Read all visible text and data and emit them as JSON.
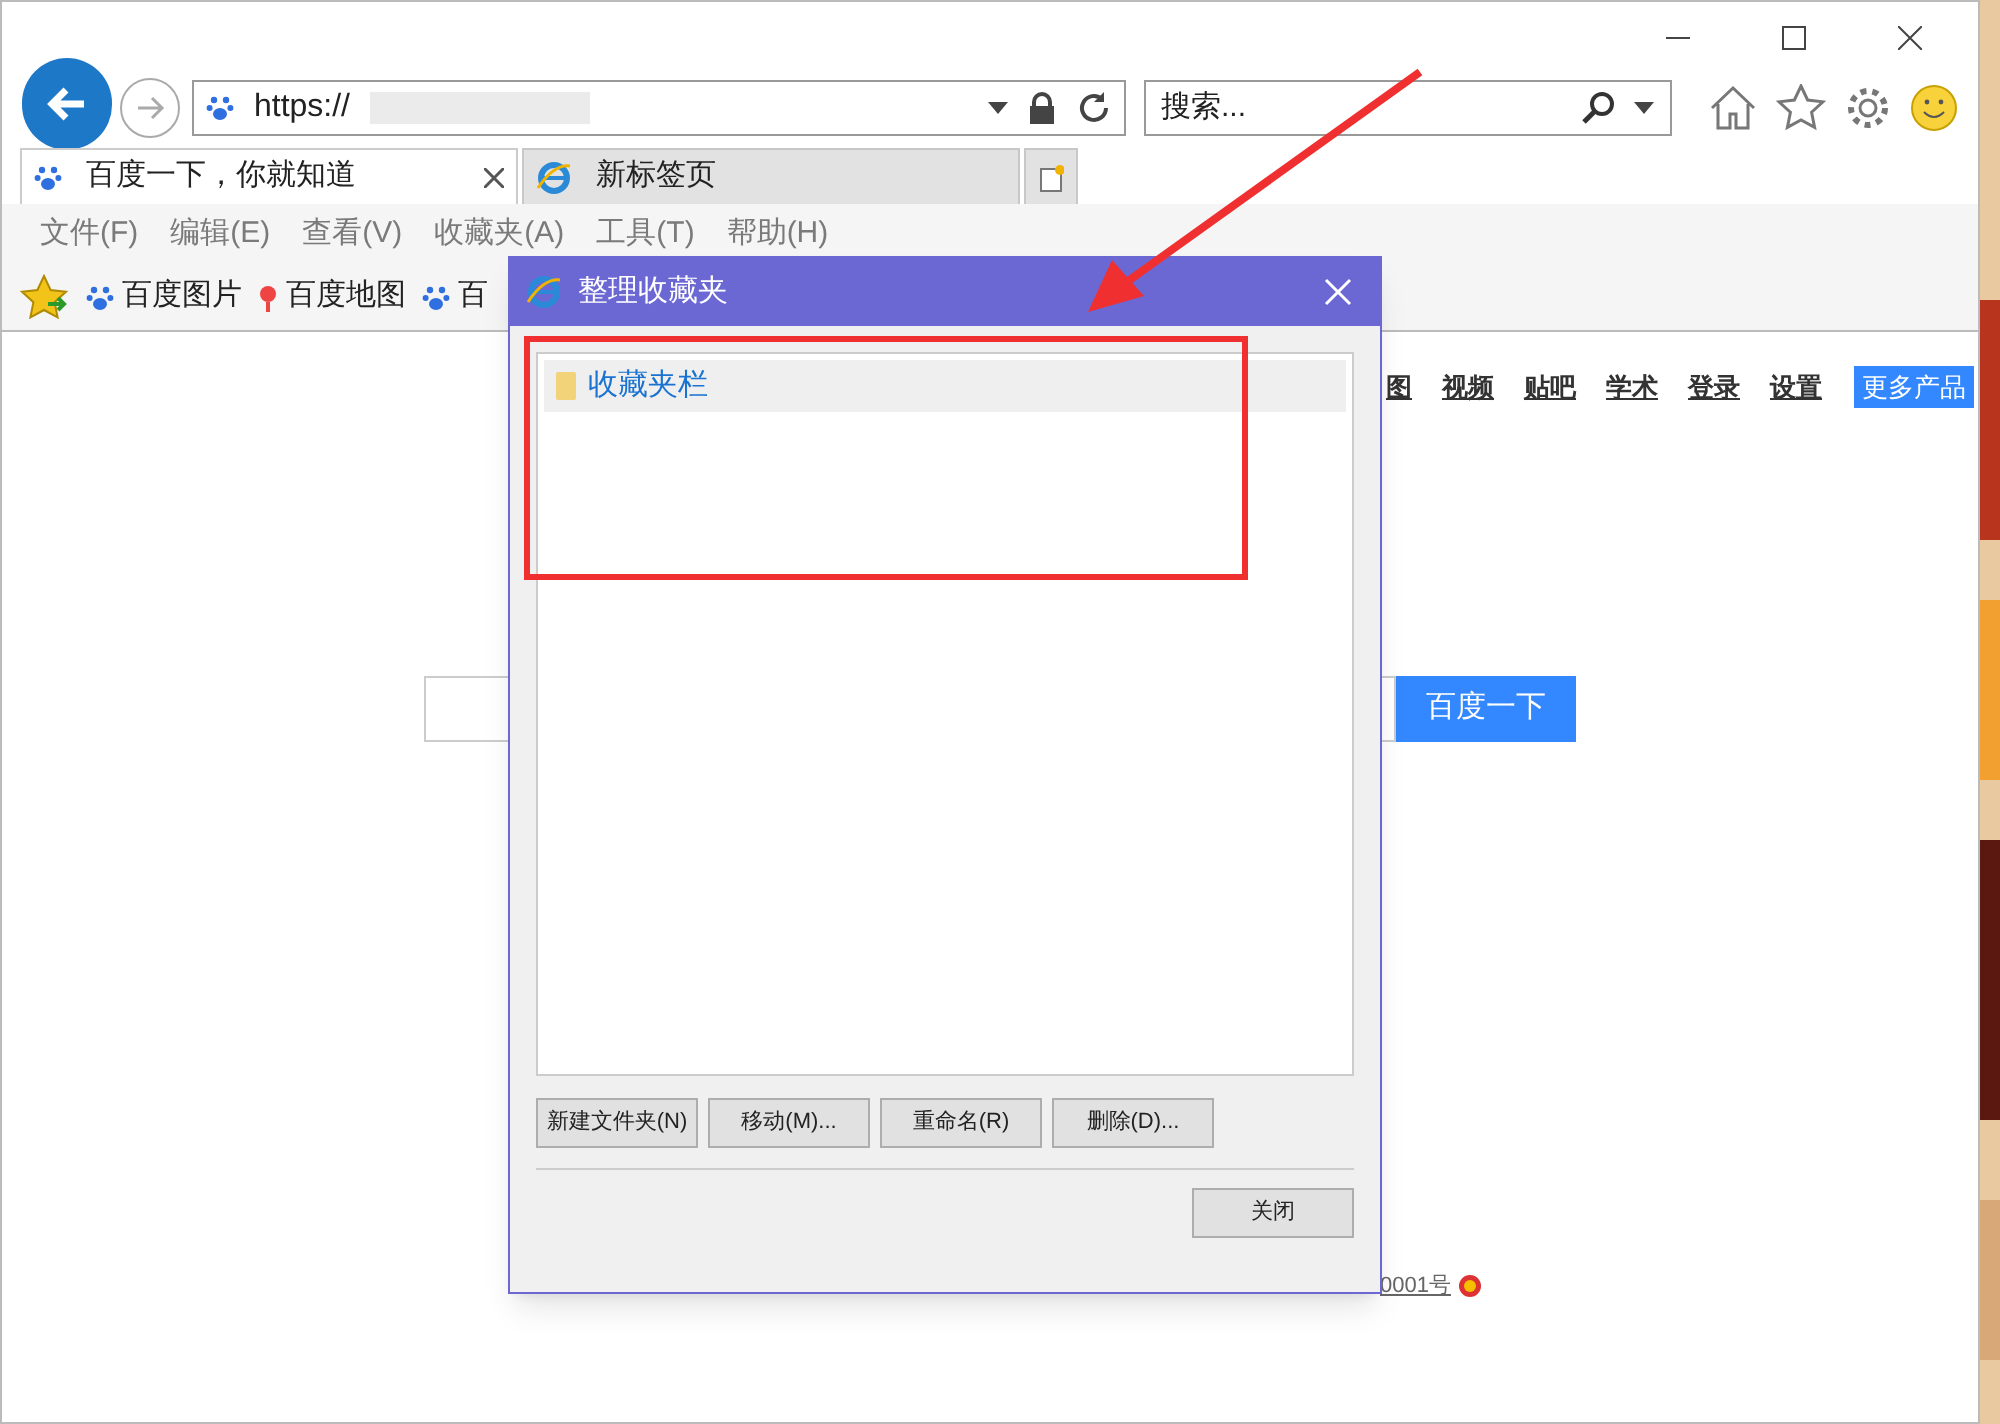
{
  "address_bar": {
    "url": "https://"
  },
  "search_field": {
    "placeholder": "搜索..."
  },
  "tabs": [
    {
      "label": "百度一下，你就知道",
      "selected": true
    },
    {
      "label": "新标签页",
      "selected": false
    }
  ],
  "menu": [
    "文件(F)",
    "编辑(E)",
    "查看(V)",
    "收藏夹(A)",
    "工具(T)",
    "帮助(H)"
  ],
  "favorites_bar": [
    "百度图片",
    "百度地图",
    "百"
  ],
  "page": {
    "nav_links": [
      "图",
      "视频",
      "贴吧",
      "学术",
      "登录",
      "设置"
    ],
    "more_button": "更多产品",
    "search_button": "百度一下",
    "footer": "0001号"
  },
  "dialog": {
    "title": "整理收藏夹",
    "items": [
      {
        "label": "收藏夹栏",
        "selected": true
      }
    ],
    "buttons": [
      "新建文件夹(N)",
      "移动(M)...",
      "重命名(R)",
      "删除(D)..."
    ],
    "close_button": "关闭"
  }
}
